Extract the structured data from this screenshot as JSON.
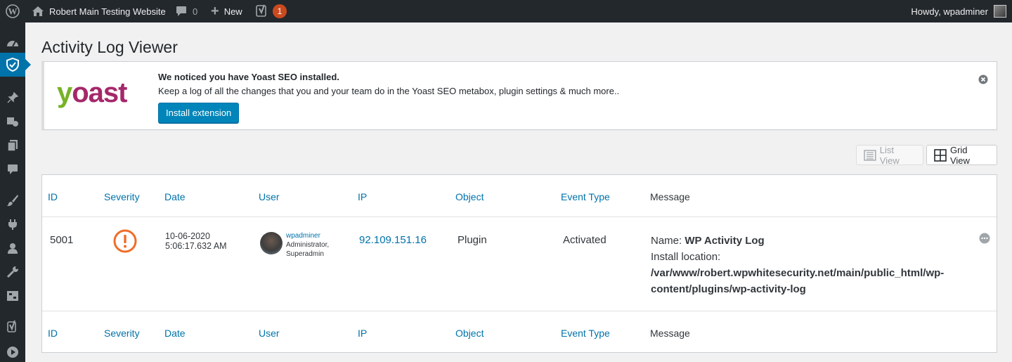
{
  "adminbar": {
    "site_name": "Robert Main Testing Website",
    "comments_count": "0",
    "new_label": "New",
    "yoast_badge": "1",
    "howdy": "Howdy, wpadminer"
  },
  "page": {
    "title": "Activity Log Viewer"
  },
  "notice": {
    "logo_text_y": "y",
    "logo_text_rest": "oast",
    "title": "We noticed you have Yoast SEO installed.",
    "text": "Keep a log of all the changes that you and your team do in the Yoast SEO metabox, plugin settings & much more..",
    "button": "Install extension"
  },
  "views": {
    "list": "List View",
    "grid": "Grid View",
    "active": "grid"
  },
  "table": {
    "headers": [
      "ID",
      "Severity",
      "Date",
      "User",
      "IP",
      "Object",
      "Event Type",
      "Message"
    ],
    "row": {
      "id": "5001",
      "date": "10-06-2020",
      "time": "5:06:17.632 AM",
      "user_name": "wpadminer",
      "user_role1": "Administrator,",
      "user_role2": "Superadmin",
      "ip": "92.109.151.16",
      "object": "Plugin",
      "event_type": "Activated",
      "msg_name_label": "Name: ",
      "msg_name_value": "WP Activity Log",
      "msg_location_label": "Install location:",
      "msg_location_value": "/var/www/robert.wpwhitesecurity.net/main/public_html/wp-content/plugins/wp-activity-log"
    }
  },
  "colors": {
    "accent": "#0073aa",
    "severity": "#f06d28",
    "yoast_purple": "#a4286a",
    "yoast_green": "#77b227",
    "badge": "#ca4a1f"
  }
}
